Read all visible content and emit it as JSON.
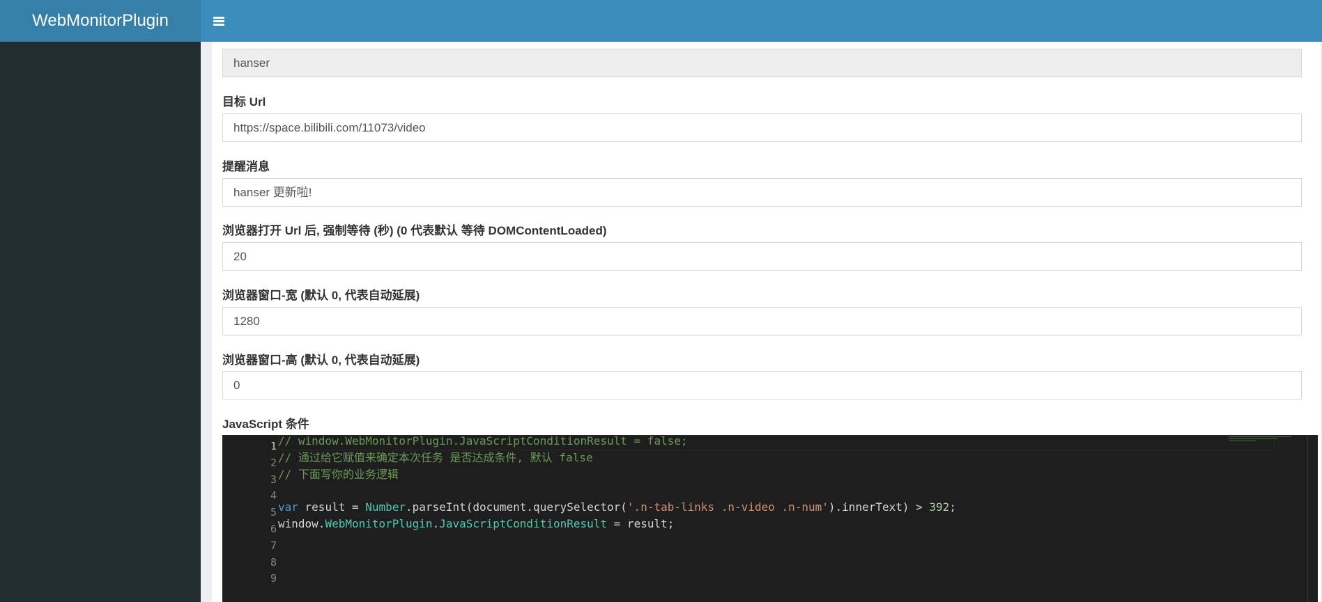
{
  "header": {
    "logo": "WebMonitorPlugin",
    "menu_icon": "hamburger-icon"
  },
  "form": {
    "name_value": "hanser",
    "target_url_label": "目标 Url",
    "target_url_value": "https://space.bilibili.com/11073/video",
    "message_label": "提醒消息",
    "message_value": "hanser 更新啦!",
    "wait_label": "浏览器打开 Url 后, 强制等待 (秒) (0 代表默认 等待 DOMContentLoaded)",
    "wait_value": "20",
    "width_label": "浏览器窗口-宽 (默认 0, 代表自动延展)",
    "width_value": "1280",
    "height_label": "浏览器窗口-高 (默认 0, 代表自动延展)",
    "height_value": "0",
    "js_label": "JavaScript 条件"
  },
  "editor": {
    "line_numbers": [
      "1",
      "2",
      "3",
      "4",
      "5",
      "6",
      "7",
      "8",
      "9"
    ],
    "lines": [
      [
        {
          "t": "// window.WebMonitorPlugin.JavaScriptConditionResult = false;",
          "c": "c-com"
        }
      ],
      [
        {
          "t": "// 通过给它赋值来确定本次任务 是否达成条件, 默认 false",
          "c": "c-com"
        }
      ],
      [
        {
          "t": "// 下面写你的业务逻辑",
          "c": "c-com"
        }
      ],
      [],
      [
        {
          "t": "var",
          "c": "c-kw"
        },
        {
          "t": " result = ",
          "c": "c-plain"
        },
        {
          "t": "Number",
          "c": "c-type"
        },
        {
          "t": ".parseInt(document.querySelector(",
          "c": "c-plain"
        },
        {
          "t": "'.n-tab-links .n-video .n-num'",
          "c": "c-str"
        },
        {
          "t": ").innerText) > ",
          "c": "c-plain"
        },
        {
          "t": "392",
          "c": "c-num"
        },
        {
          "t": ";",
          "c": "c-plain"
        }
      ],
      [
        {
          "t": "window.",
          "c": "c-plain"
        },
        {
          "t": "WebMonitorPlugin",
          "c": "c-type"
        },
        {
          "t": ".",
          "c": "c-plain"
        },
        {
          "t": "JavaScriptConditionResult",
          "c": "c-type"
        },
        {
          "t": " = result;",
          "c": "c-plain"
        }
      ],
      [],
      [],
      []
    ]
  }
}
